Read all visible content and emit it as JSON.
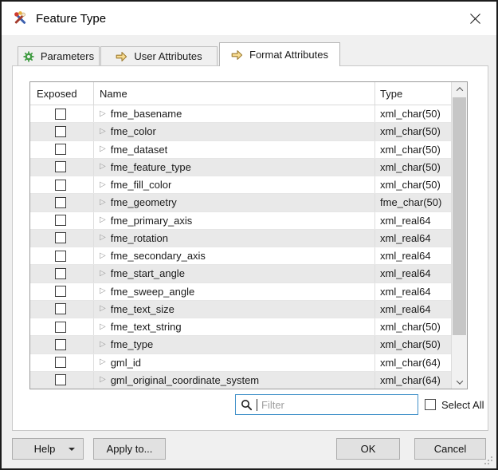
{
  "window": {
    "title": "Feature Type"
  },
  "icons": {
    "expand": "▷"
  },
  "tabs": [
    {
      "label": "Parameters",
      "active": false
    },
    {
      "label": "User Attributes",
      "active": false
    },
    {
      "label": "Format Attributes",
      "active": true
    }
  ],
  "table": {
    "headers": {
      "exposed": "Exposed",
      "name": "Name",
      "type": "Type"
    },
    "rows": [
      {
        "exposed": false,
        "name": "fme_basename",
        "type": "xml_char(50)"
      },
      {
        "exposed": false,
        "name": "fme_color",
        "type": "xml_char(50)"
      },
      {
        "exposed": false,
        "name": "fme_dataset",
        "type": "xml_char(50)"
      },
      {
        "exposed": false,
        "name": "fme_feature_type",
        "type": "xml_char(50)"
      },
      {
        "exposed": false,
        "name": "fme_fill_color",
        "type": "xml_char(50)"
      },
      {
        "exposed": false,
        "name": "fme_geometry",
        "type": "fme_char(50)"
      },
      {
        "exposed": false,
        "name": "fme_primary_axis",
        "type": "xml_real64"
      },
      {
        "exposed": false,
        "name": "fme_rotation",
        "type": "xml_real64"
      },
      {
        "exposed": false,
        "name": "fme_secondary_axis",
        "type": "xml_real64"
      },
      {
        "exposed": false,
        "name": "fme_start_angle",
        "type": "xml_real64"
      },
      {
        "exposed": false,
        "name": "fme_sweep_angle",
        "type": "xml_real64"
      },
      {
        "exposed": false,
        "name": "fme_text_size",
        "type": "xml_real64"
      },
      {
        "exposed": false,
        "name": "fme_text_string",
        "type": "xml_char(50)"
      },
      {
        "exposed": false,
        "name": "fme_type",
        "type": "xml_char(50)"
      },
      {
        "exposed": false,
        "name": "gml_id",
        "type": "xml_char(64)"
      },
      {
        "exposed": false,
        "name": "gml_original_coordinate_system",
        "type": "xml_char(64)"
      }
    ]
  },
  "filter": {
    "placeholder": "Filter",
    "value": ""
  },
  "select_all": {
    "label": "Select All",
    "checked": false
  },
  "footer": {
    "help": "Help",
    "apply_to": "Apply to...",
    "ok": "OK",
    "cancel": "Cancel"
  },
  "colors": {
    "row-alt": "#e9e9e9",
    "filter-border": "#4191c9",
    "thumb": "#c6c6c6",
    "gear-green": "#3f9b41",
    "arrow-fill": "#f8dc92",
    "arrow-stroke": "#9c7a2e"
  }
}
